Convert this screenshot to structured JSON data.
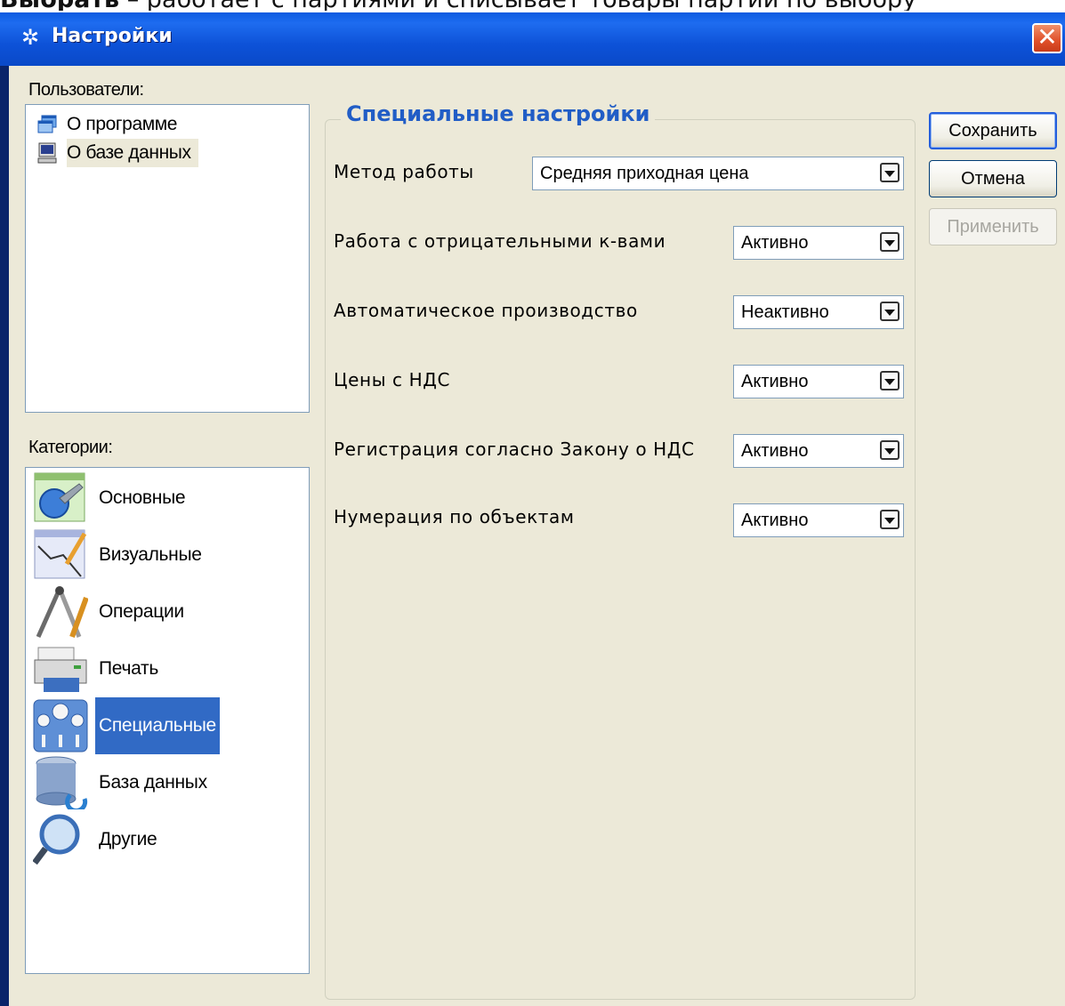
{
  "doc_caption": {
    "bold": "Выбрать",
    "rest": " – работает с партиями и списывает товары партии по выбору"
  },
  "window": {
    "title": "Настройки",
    "title_icon": "gear-icon",
    "close_icon": "close-icon"
  },
  "users": {
    "label": "Пользователи:",
    "items": [
      {
        "label": "О программе",
        "icon": "windows-icon"
      },
      {
        "label": "О базе данных",
        "icon": "computer-icon"
      }
    ]
  },
  "categories": {
    "label": "Категории:",
    "items": [
      {
        "label": "Основные",
        "icon": "wrench-globe-icon"
      },
      {
        "label": "Визуальные",
        "icon": "drawing-icon"
      },
      {
        "label": "Операции",
        "icon": "compass-icon"
      },
      {
        "label": "Печать",
        "icon": "printer-icon"
      },
      {
        "label": "Специальные",
        "icon": "gauges-icon",
        "selected": true
      },
      {
        "label": "База данных",
        "icon": "database-icon"
      },
      {
        "label": "Другие",
        "icon": "magnifier-icon"
      }
    ]
  },
  "special": {
    "title": "Специальные настройки",
    "rows": [
      {
        "label": "Метод работы",
        "value": "Средняя приходная цена"
      },
      {
        "label": "Работа с отрицательными к-вами",
        "value": "Активно"
      },
      {
        "label": "Автоматическое производство",
        "value": "Неактивно"
      },
      {
        "label": "Цены с НДС",
        "value": "Активно"
      },
      {
        "label": "Регистрация согласно Закону о НДС",
        "value": "Активно"
      },
      {
        "label": "Нумерация по объектам",
        "value": "Активно"
      }
    ]
  },
  "buttons": {
    "save": "Сохранить",
    "cancel": "Отмена",
    "apply": "Применить"
  },
  "colors": {
    "accent": "#215dc6",
    "selection": "#316ac5",
    "titlebar": "#0a5ae0"
  }
}
